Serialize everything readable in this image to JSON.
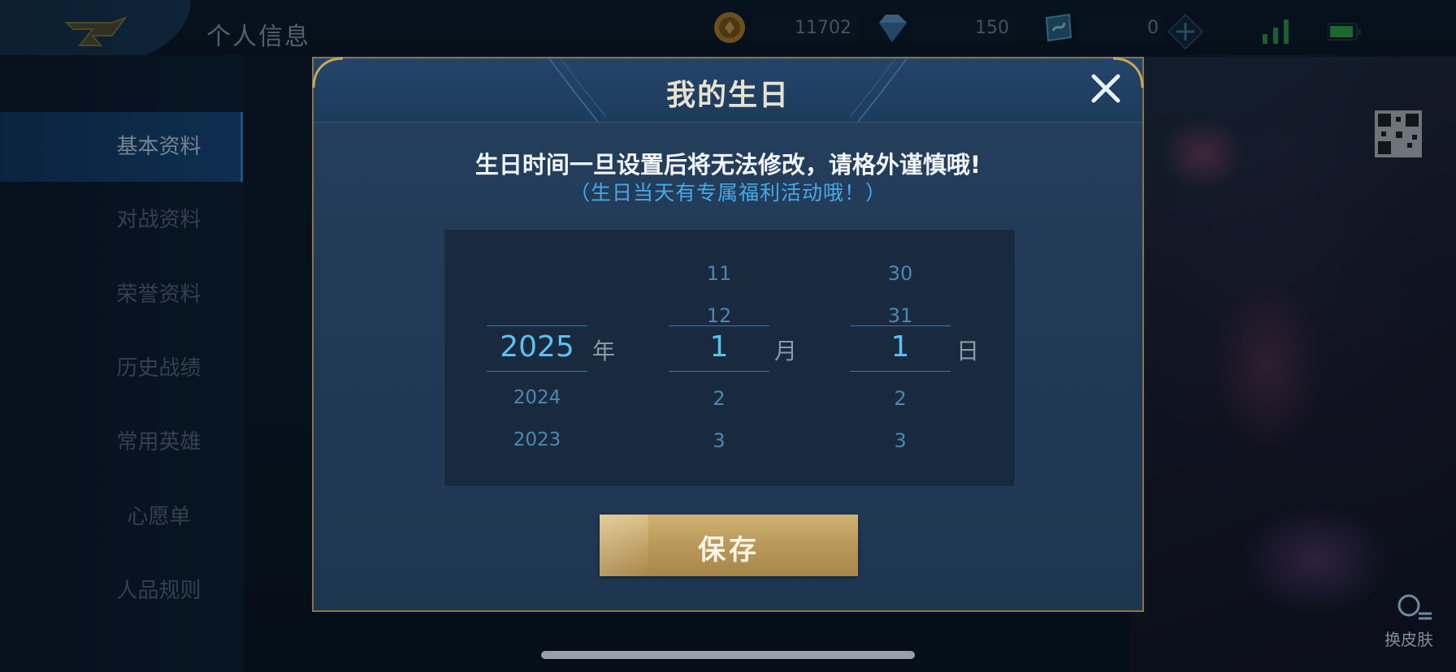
{
  "header": {
    "title": "个人信息",
    "currencies": [
      {
        "icon": "gold-coin-icon",
        "value": "11702"
      },
      {
        "icon": "diamond-icon",
        "value": "150"
      },
      {
        "icon": "voucher-icon",
        "value": "0"
      }
    ]
  },
  "sidebar": {
    "items": [
      {
        "label": "基本资料",
        "active": true
      },
      {
        "label": "对战资料"
      },
      {
        "label": "荣誉资料"
      },
      {
        "label": "历史战绩"
      },
      {
        "label": "常用英雄"
      },
      {
        "label": "心愿单"
      },
      {
        "label": "人品规则"
      }
    ]
  },
  "skin_button": {
    "label": "换皮肤"
  },
  "modal": {
    "title": "我的生日",
    "warning": "生日时间一旦设置后将无法修改，请格外谨慎哦!",
    "note": "（生日当天有专属福利活动哦！）",
    "save_label": "保存",
    "picker": {
      "year": {
        "above": [],
        "selected": "2025",
        "below": [
          "2024",
          "2023"
        ],
        "unit": "年"
      },
      "month": {
        "above": [
          "11",
          "12"
        ],
        "selected": "1",
        "below": [
          "2",
          "3"
        ],
        "unit": "月"
      },
      "day": {
        "above": [
          "30",
          "31"
        ],
        "selected": "1",
        "below": [
          "2",
          "3"
        ],
        "unit": "日"
      }
    }
  },
  "colors": {
    "accent_blue": "#47a8e6",
    "selected_value": "#5cc0f2",
    "gold_button": "#b8985a",
    "modal_border": "#8a7448"
  }
}
